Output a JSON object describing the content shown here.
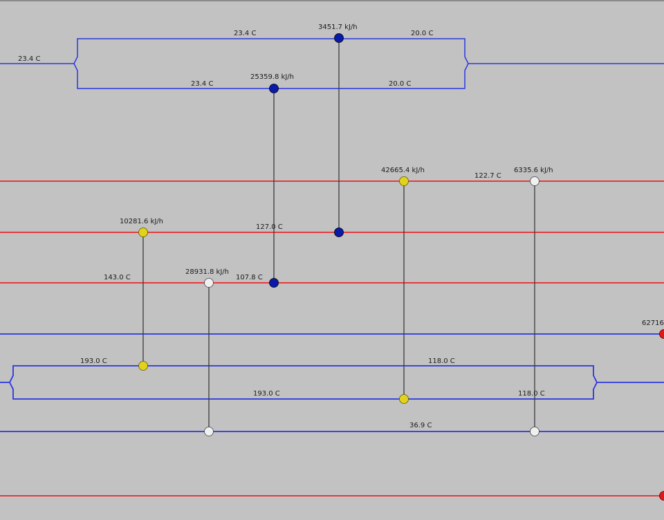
{
  "colors": {
    "background": "#c2c2c2",
    "hot_stream": "#e8262a",
    "cold_stream": "#2a36e0",
    "connector": "#3a3a3a",
    "node_blue": "#0a1aa8",
    "node_yellow": "#e2d21c",
    "node_white": "#f0f0f0",
    "node_red": "#e01818"
  },
  "labels": {
    "l1": "23.4 C",
    "l2": "23.4 C",
    "l3": "3451.7 kJ/h",
    "l4": "20.0 C",
    "l5": "23.4 C",
    "l6": "25359.8 kJ/h",
    "l7": "20.0 C",
    "l8": "42665.4 kJ/h",
    "l9": "122.7 C",
    "l10": "6335.6 kJ/h",
    "l11": "10281.6 kJ/h",
    "l12": "127.0 C",
    "l13": "143.0 C",
    "l14": "28931.8 kJ/h",
    "l15": "107.8 C",
    "l16": "62716",
    "l17": "193.0 C",
    "l18": "118.0 C",
    "l19": "193.0 C",
    "l20": "118.0 C",
    "l21": "36.9 C"
  }
}
